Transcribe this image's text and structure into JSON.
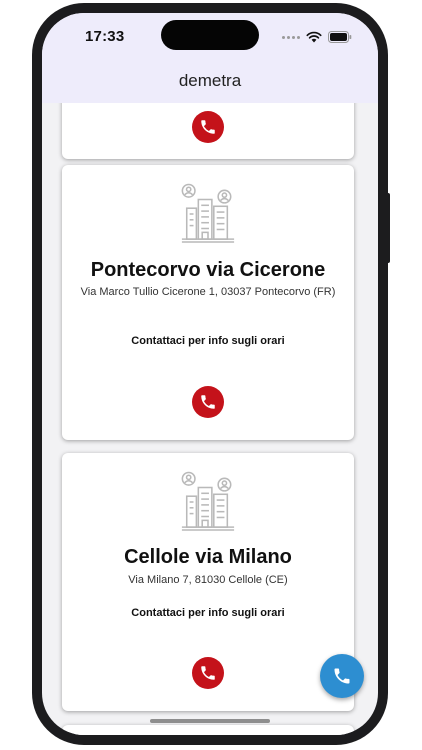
{
  "status_bar": {
    "time": "17:33"
  },
  "app": {
    "title": "demetra"
  },
  "locations": [
    {
      "name": "Pontecorvo via Cicerone",
      "address": "Via Marco Tullio Cicerone 1, 03037 Pontecorvo (FR)",
      "hours_note": "Contattaci per info sugli orari"
    },
    {
      "name": "Cellole via Milano",
      "address": "Via Milano 7, 81030 Cellole (CE)",
      "hours_note": "Contattaci per info sugli orari"
    }
  ],
  "icons": {
    "call": "phone-icon",
    "building": "building-icon",
    "fab": "phone-icon"
  },
  "colors": {
    "header_bg": "#eeecfb",
    "call_button": "#c4121a",
    "fab": "#2d8ed1",
    "card_bg": "#ffffff",
    "screen_bg": "#f2f2f4"
  }
}
